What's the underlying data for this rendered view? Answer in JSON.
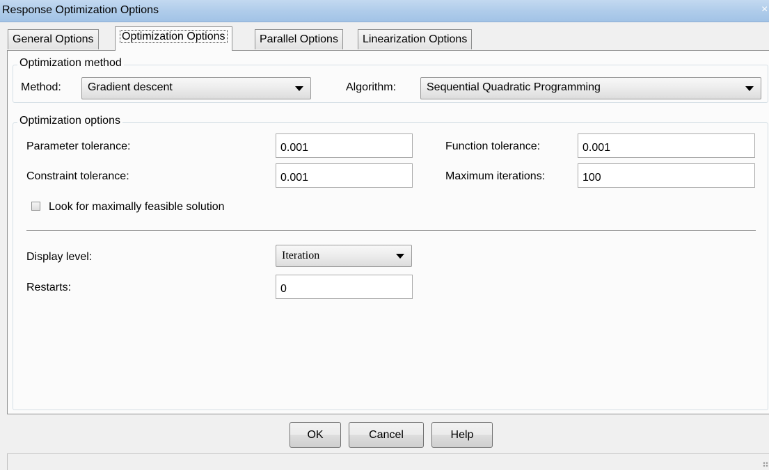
{
  "window": {
    "title": "Response Optimization Options",
    "close_glyph": "×"
  },
  "tabs": [
    {
      "label": "General Options",
      "active": false
    },
    {
      "label": "Optimization Options",
      "active": true
    },
    {
      "label": "Parallel Options",
      "active": false
    },
    {
      "label": "Linearization Options",
      "active": false
    }
  ],
  "method_group": {
    "title": "Optimization method",
    "method_label": "Method:",
    "method_value": "Gradient descent",
    "algorithm_label": "Algorithm:",
    "algorithm_value": "Sequential Quadratic Programming"
  },
  "options_group": {
    "title": "Optimization options",
    "parameter_tolerance_label": "Parameter tolerance:",
    "parameter_tolerance_value": "0.001",
    "function_tolerance_label": "Function tolerance:",
    "function_tolerance_value": "0.001",
    "constraint_tolerance_label": "Constraint tolerance:",
    "constraint_tolerance_value": "0.001",
    "max_iterations_label": "Maximum iterations:",
    "max_iterations_value": "100",
    "feasible_checkbox_label": "Look for maximally feasible solution",
    "feasible_checked": false,
    "display_level_label": "Display level:",
    "display_level_value": "Iteration",
    "restarts_label": "Restarts:",
    "restarts_value": "0"
  },
  "buttons": {
    "ok": "OK",
    "cancel": "Cancel",
    "help": "Help"
  }
}
